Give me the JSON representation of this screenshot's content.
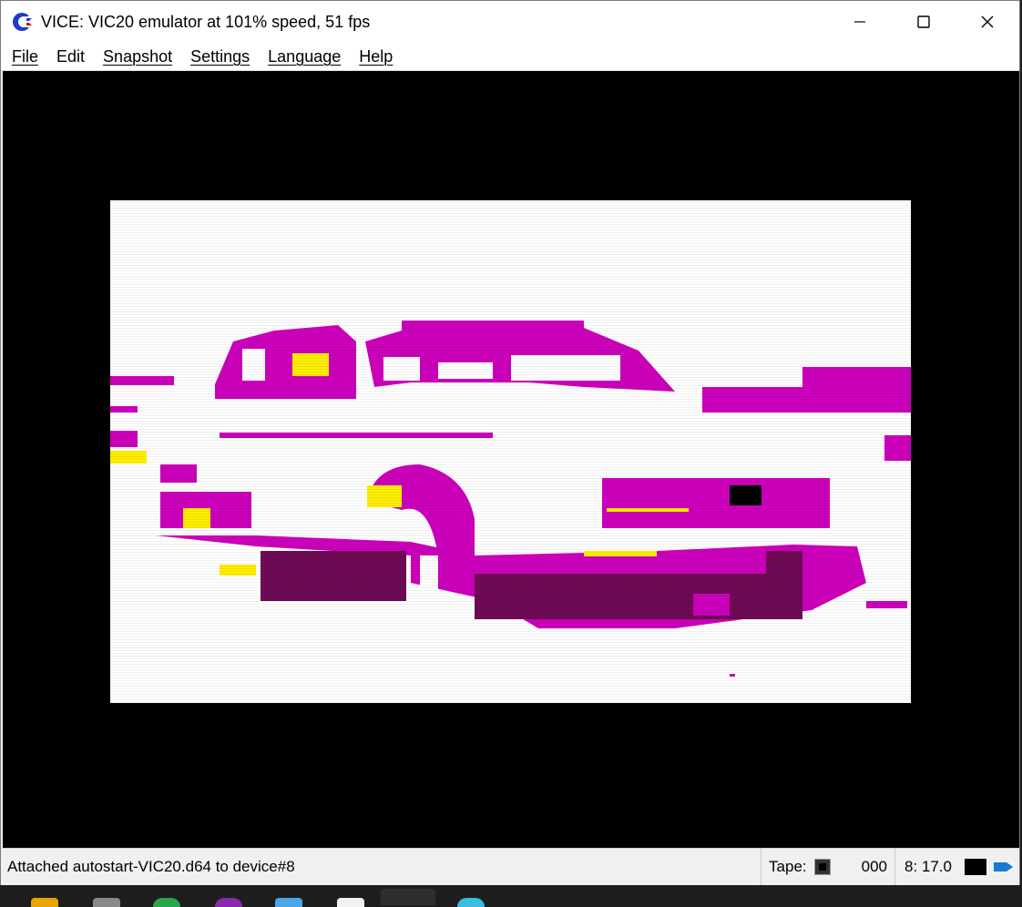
{
  "window": {
    "title": "VICE: VIC20 emulator at 101% speed, 51 fps"
  },
  "menu": {
    "items": [
      {
        "label": "File"
      },
      {
        "label": "Edit"
      },
      {
        "label": "Snapshot"
      },
      {
        "label": "Settings"
      },
      {
        "label": "Language"
      },
      {
        "label": "Help"
      }
    ]
  },
  "screen": {
    "content": "vic20-car-bitmap",
    "colors": {
      "border": "#000000",
      "background": "#ffffff",
      "magenta": "#cc00bb",
      "dark_magenta": "#6e0a55",
      "yellow": "#ffee00",
      "black": "#000000"
    }
  },
  "status": {
    "message": "Attached autostart-VIC20.d64 to device#8",
    "tape_label": "Tape:",
    "tape_counter": "000",
    "drive": "8: 17.0"
  },
  "taskbar": {
    "icons": [
      "folder-icon",
      "drive-icon",
      "chrome-icon",
      "podcast-icon",
      "notepad-icon",
      "document-icon",
      "vice-icon",
      "edge-icon"
    ]
  }
}
